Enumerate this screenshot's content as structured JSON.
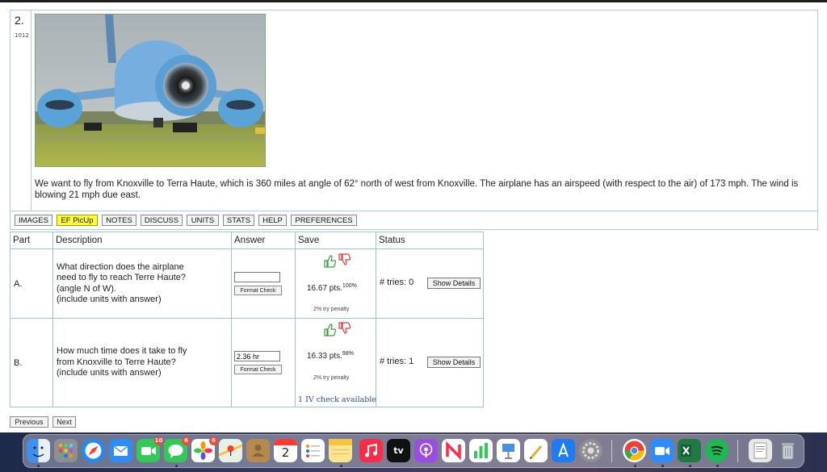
{
  "problem": {
    "number": "2.",
    "id": "1012",
    "prompt": "We want to fly from Knoxville to Terra Haute, which is 360 miles at angle of 62° north of west from Knoxville. The airplane has an airspeed (with respect to the air) of 173 mph. The wind is blowing 21 mph due east."
  },
  "toolbar": {
    "buttons": [
      "IMAGES",
      "EF PicUp",
      "NOTES",
      "DISCUSS",
      "UNITS",
      "STATS",
      "HELP",
      "PREFERENCES"
    ]
  },
  "table": {
    "headers": [
      "Part",
      "Description",
      "Answer",
      "Save",
      "Status"
    ],
    "rows": [
      {
        "part": "A.",
        "description": [
          "What direction does the airplane",
          "need to fly to reach Terre Haute?",
          "(angle N of W).",
          "(include units with answer)"
        ],
        "answer_value": "",
        "format_check": "Format Check",
        "points": "16.67 pts.",
        "percent": "100%",
        "penalty": "2% try penalty",
        "tries": "# tries: 0",
        "show_details": "Show Details"
      },
      {
        "part": "B.",
        "description": [
          "How much time does it take to fly",
          "from Knoxville to Terre Haute?",
          "(include units with answer)"
        ],
        "answer_value": "2.36 hr",
        "format_check": "Format Check",
        "points": "16.33 pts.",
        "percent": "98%",
        "penalty": "2% try penalty",
        "iv_check": "1 IV check available",
        "tries": "# tries: 1",
        "show_details": "Show Details"
      }
    ]
  },
  "nav": {
    "previous": "Previous",
    "next": "Next"
  },
  "dock": {
    "calendar_day": "2",
    "tv_label": "tv",
    "badges": {
      "facetime": "10",
      "messages": "6",
      "photos": "6"
    }
  },
  "colors": {
    "table_border": "#9cc3d6",
    "highlight": "#ffff33",
    "thumb_up": "#3a9a3a",
    "thumb_down": "#e03a3a"
  }
}
